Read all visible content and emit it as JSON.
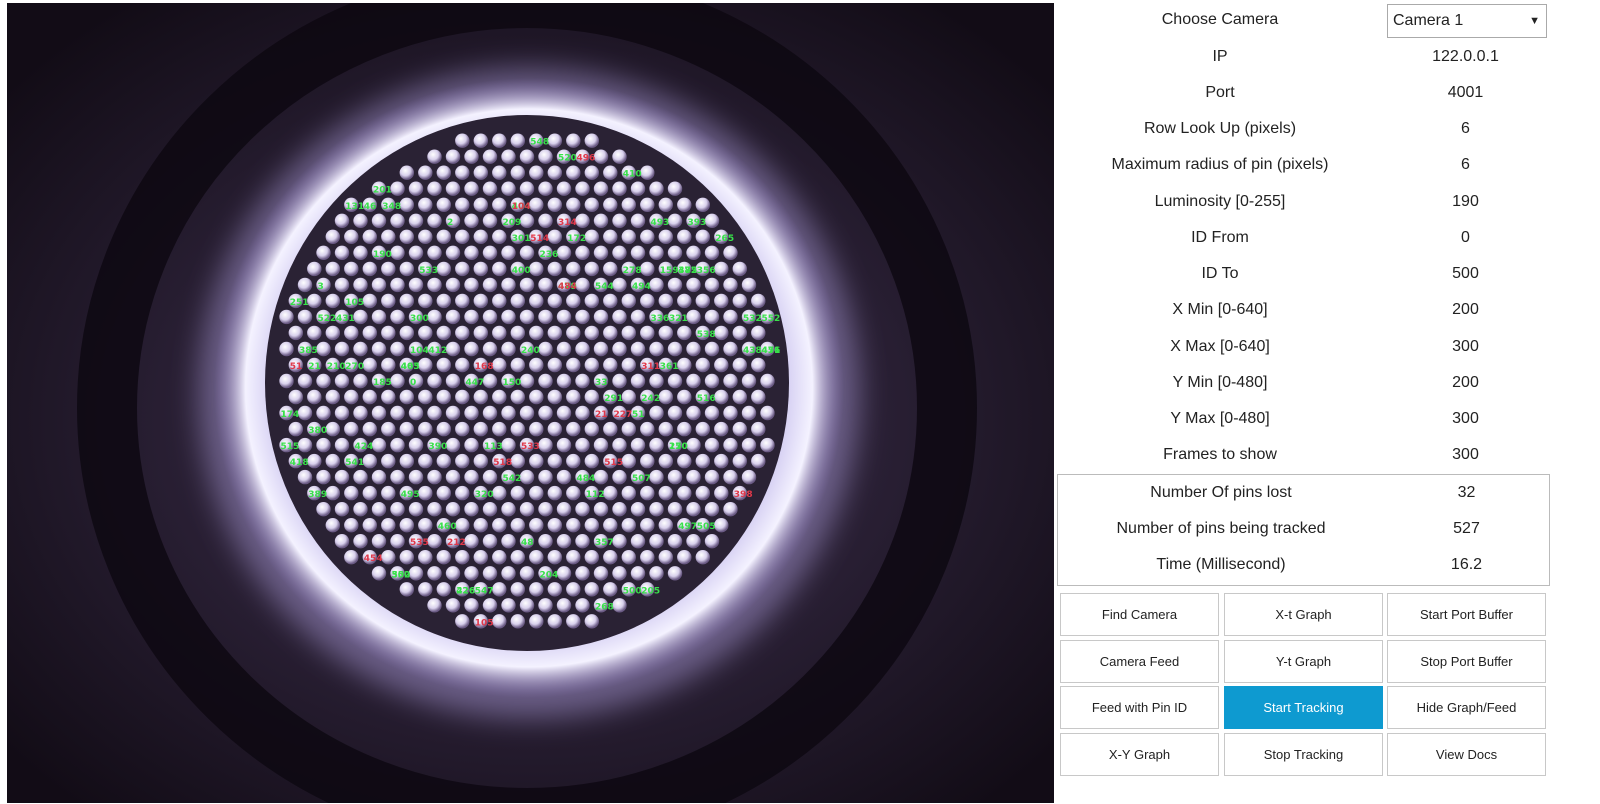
{
  "feed": {
    "visible_green_labels": [
      "0",
      "1",
      "2",
      "3",
      "21",
      "33",
      "46",
      "48",
      "51",
      "104",
      "105",
      "112",
      "113",
      "131",
      "150",
      "159",
      "170",
      "172",
      "174",
      "185",
      "190",
      "201",
      "204",
      "205",
      "209",
      "210",
      "226",
      "236",
      "240",
      "242",
      "250",
      "251",
      "265",
      "268",
      "270",
      "278",
      "291",
      "300",
      "301",
      "320",
      "321",
      "336",
      "348",
      "350",
      "356",
      "357",
      "361",
      "375",
      "380",
      "385",
      "389",
      "390",
      "393",
      "400",
      "403",
      "404",
      "410",
      "412",
      "418",
      "424",
      "426",
      "431",
      "438",
      "447",
      "451",
      "460",
      "465",
      "476",
      "479",
      "482",
      "484",
      "493",
      "494",
      "495",
      "497",
      "500",
      "502",
      "505",
      "507",
      "515",
      "516",
      "520",
      "522",
      "532",
      "533",
      "538",
      "541",
      "542",
      "544",
      "547",
      "548",
      "552"
    ],
    "visible_red_labels": [
      "21",
      "51",
      "104",
      "105",
      "168",
      "212",
      "227",
      "311",
      "314",
      "398",
      "454",
      "484",
      "496",
      "514",
      "515",
      "518",
      "533",
      "535"
    ],
    "colors": {
      "green_label": "#38e04a",
      "red_label": "#e0384a",
      "glow": "#e8e4ff"
    }
  },
  "settings": {
    "choose_camera_label": "Choose Camera",
    "camera_selected": "Camera 1",
    "rows": [
      {
        "label": "IP",
        "value": "122.0.0.1"
      },
      {
        "label": "Port",
        "value": "4001"
      },
      {
        "label": "Row Look Up (pixels)",
        "value": "6"
      },
      {
        "label": "Maximum radius of pin (pixels)",
        "value": "6"
      },
      {
        "label": "Luminosity [0-255]",
        "value": "190"
      },
      {
        "label": "ID From",
        "value": "0"
      },
      {
        "label": "ID To",
        "value": "500"
      },
      {
        "label": "X Min [0-640]",
        "value": "200"
      },
      {
        "label": "X Max [0-640]",
        "value": "300"
      },
      {
        "label": "Y Min [0-480]",
        "value": "200"
      },
      {
        "label": "Y Max [0-480]",
        "value": "300"
      },
      {
        "label": "Frames to show",
        "value": "300"
      }
    ]
  },
  "stats": [
    {
      "label": "Number Of pins lost",
      "value": "32"
    },
    {
      "label": "Number of pins being tracked",
      "value": "527"
    },
    {
      "label": "Time (Millisecond)",
      "value": "16.2"
    }
  ],
  "buttons": [
    {
      "label": "Find Camera",
      "name": "find-camera-button",
      "primary": false
    },
    {
      "label": "X-t Graph",
      "name": "x-t-graph-button",
      "primary": false
    },
    {
      "label": "Start Port Buffer",
      "name": "start-port-buffer-button",
      "primary": false
    },
    {
      "label": "Camera Feed",
      "name": "camera-feed-button",
      "primary": false
    },
    {
      "label": "Y-t Graph",
      "name": "y-t-graph-button",
      "primary": false
    },
    {
      "label": "Stop Port Buffer",
      "name": "stop-port-buffer-button",
      "primary": false
    },
    {
      "label": "Feed with Pin ID",
      "name": "feed-with-pin-id-button",
      "primary": false
    },
    {
      "label": "Start Tracking",
      "name": "start-tracking-button",
      "primary": true
    },
    {
      "label": "Hide Graph/Feed",
      "name": "hide-graph-feed-button",
      "primary": false
    },
    {
      "label": "X-Y Graph",
      "name": "x-y-graph-button",
      "primary": false
    },
    {
      "label": "Stop Tracking",
      "name": "stop-tracking-button",
      "primary": false
    },
    {
      "label": "View Docs",
      "name": "view-docs-button",
      "primary": false
    }
  ],
  "colors": {
    "accent": "#0e9ad0",
    "border": "#c8c8c8"
  }
}
